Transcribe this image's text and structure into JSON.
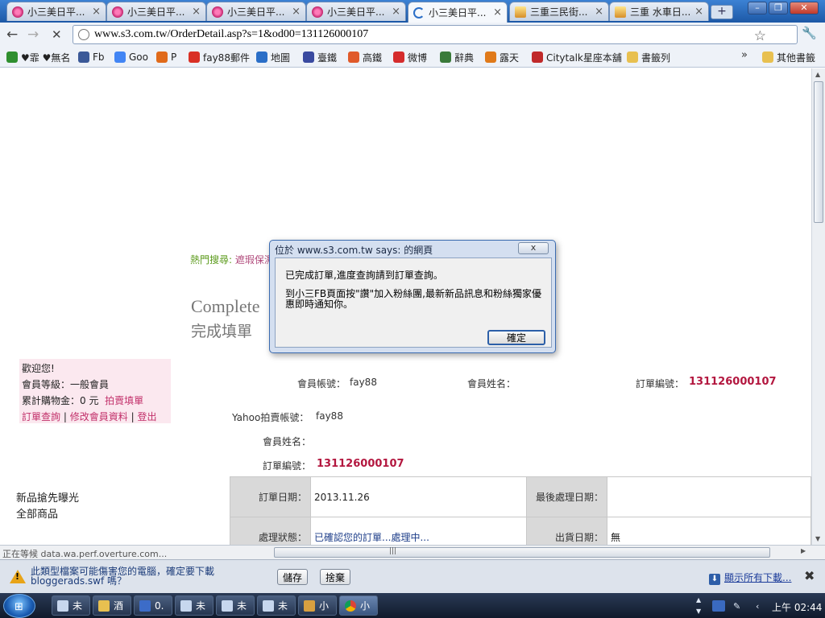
{
  "tabs": [
    {
      "label": "小三美日平...",
      "close": "×"
    },
    {
      "label": "小三美日平...",
      "close": "×"
    },
    {
      "label": "小三美日平...",
      "close": "×"
    },
    {
      "label": "小三美日平...",
      "close": "×"
    },
    {
      "label": "小三美日平...",
      "close": "×"
    },
    {
      "label": "三重三民街...",
      "close": "×"
    },
    {
      "label": "三重 水車日...",
      "close": "×"
    }
  ],
  "active_tab_index": 4,
  "new_tab_label": "+",
  "window_controls": {
    "minimize": "–",
    "maximize": "❐",
    "close": "✕"
  },
  "toolbar": {
    "back": "←",
    "forward": "→",
    "stop": "✕",
    "star": "☆",
    "wrench": "🔧"
  },
  "address": {
    "url": "www.s3.com.tw/OrderDetail.asp?s=1&od00=131126000107"
  },
  "bookmarks": [
    {
      "label": "♥霏 ♥無名",
      "color": "#2f8f2f"
    },
    {
      "label": "Fb",
      "color": "#3b5998"
    },
    {
      "label": "Goo",
      "color": "#4285f4"
    },
    {
      "label": "P",
      "color": "#e06a1a"
    },
    {
      "label": "fay88郵件",
      "color": "#d93025"
    },
    {
      "label": "地圖",
      "color": "#2a6ec7"
    },
    {
      "label": "臺鐵",
      "color": "#3a4aa0"
    },
    {
      "label": "高鐵",
      "color": "#e05a2a"
    },
    {
      "label": "微博",
      "color": "#d52c2c"
    },
    {
      "label": "辭典",
      "color": "#3a7a3a"
    },
    {
      "label": "露天",
      "color": "#e07a1a"
    },
    {
      "label": "Citytalk星座本舖",
      "color": "#c02a2a"
    },
    {
      "label": "書籤列",
      "color": "#e8c050"
    }
  ],
  "bookmarks_more": "»",
  "bookmarks_other": "其他書籤",
  "page": {
    "hot_label": "熱門搜尋:",
    "hot_link": "遮瑕保濕",
    "complete_en": "Complete",
    "complete_zh": "完成填單",
    "member": {
      "welcome": "歡迎您!",
      "level": "會員等級：一般會員",
      "total": "累計購物金：0 元",
      "auction": "拍賣填單",
      "order_query": "訂單查詢",
      "edit": "修改會員資料",
      "logout": "登出",
      "sep": "|"
    },
    "account_label": "會員帳號：",
    "account_value": "fay88",
    "name_label": "會員姓名：",
    "order_no_label": "訂單編號：",
    "order_no": "131126000107",
    "yahoo_label": "Yahoo拍賣帳號：",
    "yahoo_value": "fay88",
    "name_label2": "會員姓名：",
    "order_no_label2": "訂單編號：",
    "order_no2": "131126000107",
    "sidenav": [
      "新品搶先曝光",
      "全部商品"
    ],
    "table": {
      "order_date_label": "訂單日期：",
      "order_date": "2013.11.26",
      "last_processed_label": "最後處理日期：",
      "last_processed": "",
      "status_label": "處理狀態：",
      "status": "已確認您的訂單...處理中...",
      "ship_date_label": "出貨日期：",
      "ship_date": "無"
    }
  },
  "dialog": {
    "title": "位於 www.s3.com.tw says: 的網頁",
    "close": "x",
    "message1": "已完成訂單,進度查詢請到訂單查詢。",
    "message2": "到小三FB頁面按\"讚\"加入粉絲團,最新新品訊息和粉絲獨家優惠即時通知你。",
    "ok": "確定"
  },
  "status_bar": {
    "text": "正在等候 data.wa.perf.overture.com...",
    "grip": "|||"
  },
  "download_bar": {
    "warning": "此類型檔案可能傷害您的電腦，確定要下載 bloggerads.swf 嗎？",
    "save": "儲存",
    "discard": "捨棄",
    "show_all": "顯示所有下載...",
    "close": "✖"
  },
  "taskbar": {
    "start": "⊞",
    "tasks": [
      {
        "label": "未"
      },
      {
        "label": "酒"
      },
      {
        "label": "0."
      },
      {
        "label": "未"
      },
      {
        "label": "未"
      },
      {
        "label": "未"
      },
      {
        "label": "小"
      },
      {
        "label": "小"
      }
    ],
    "active_task_index": 7,
    "clock": "上午 02:44"
  }
}
